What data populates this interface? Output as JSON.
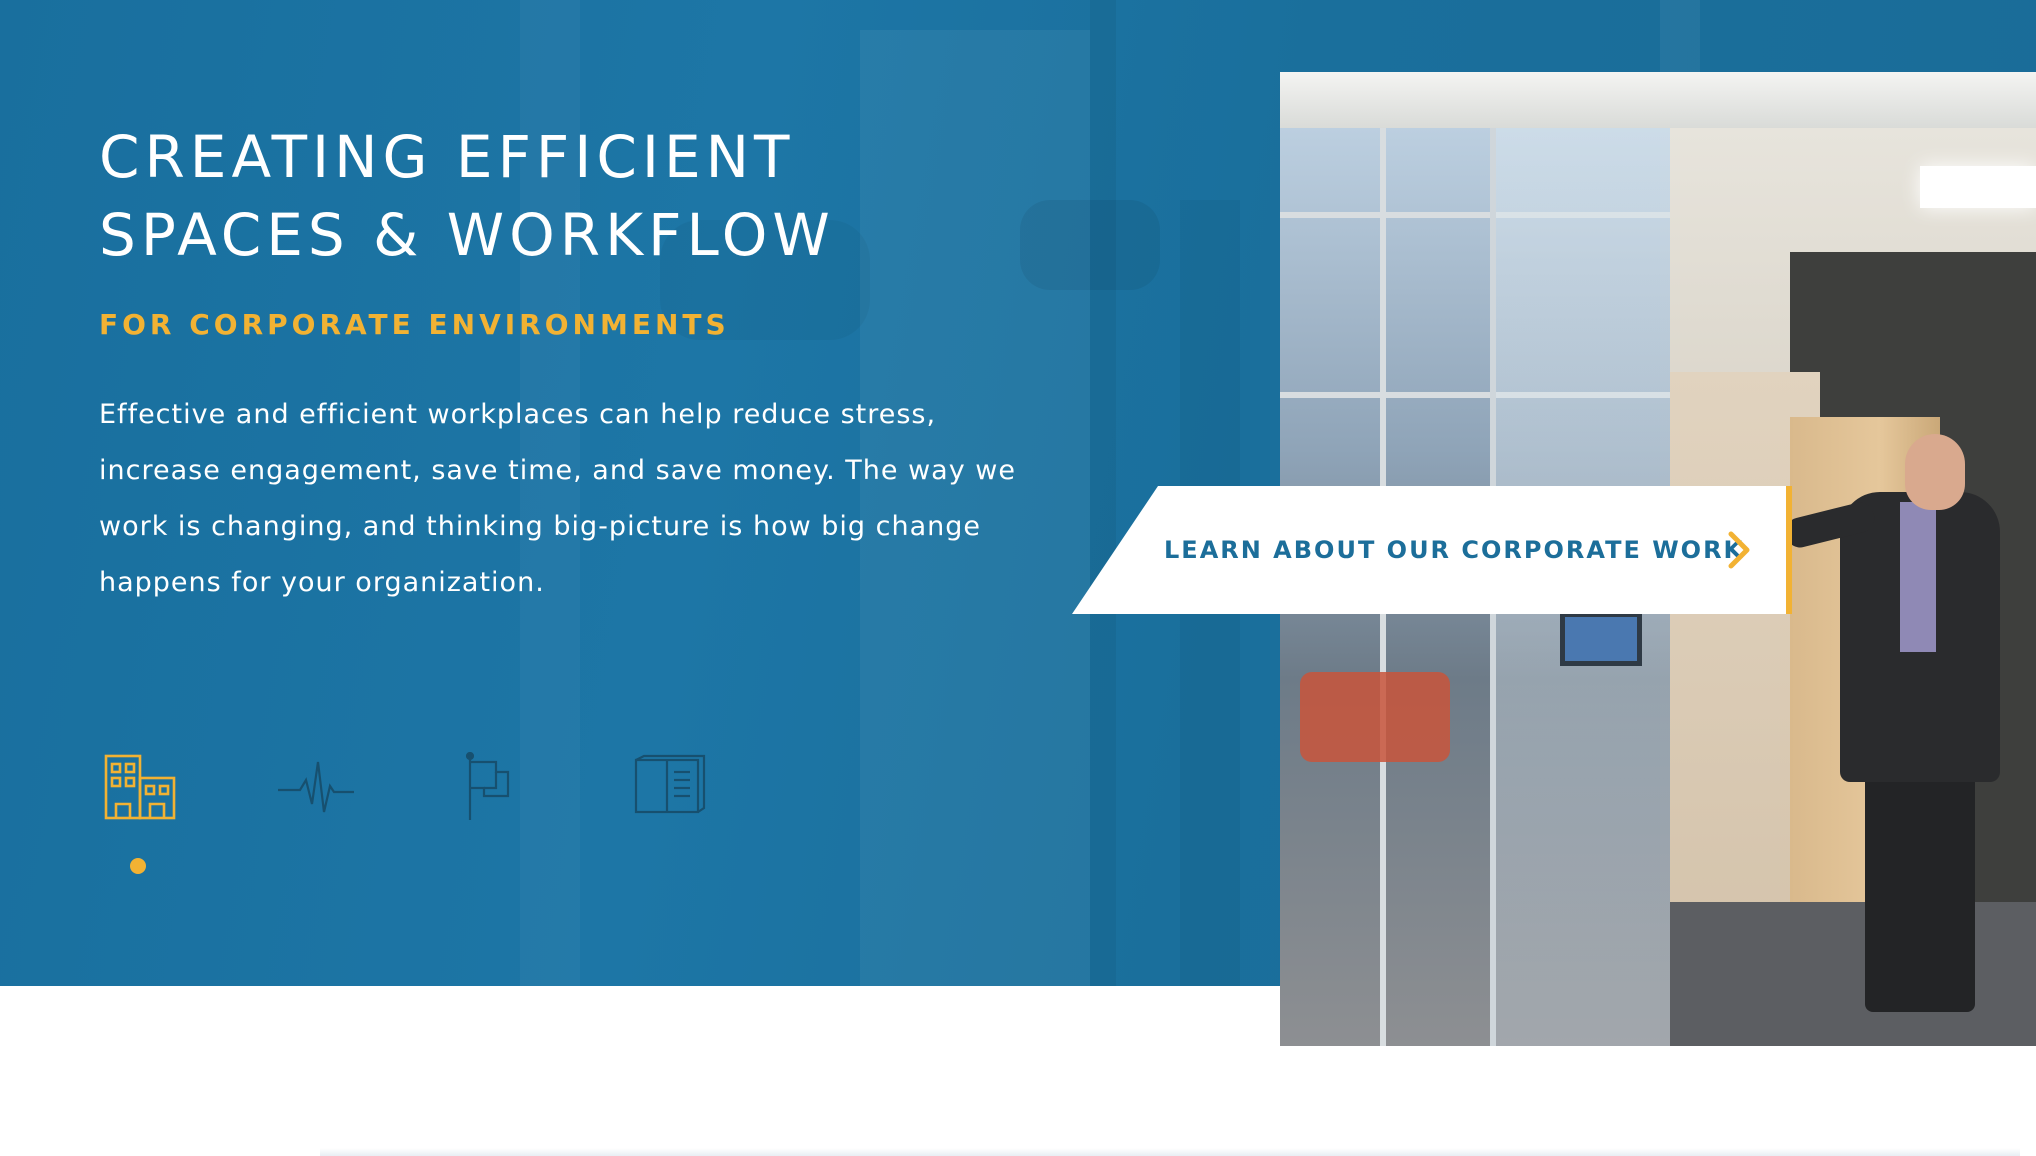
{
  "hero": {
    "title_line1": "CREATING EFFICIENT",
    "title_line2": "SPACES & WORKFLOW",
    "subtitle": "FOR CORPORATE ENVIRONMENTS",
    "body": "Effective and efficient workplaces can help reduce stress, increase engagement, save time, and save money. The way we work is changing, and thinking big-picture is how big change happens for your organization."
  },
  "cta": {
    "label": "LEARN ABOUT OUR CORPORATE WORK",
    "arrow_icon": "chevron-right-icon"
  },
  "sectors": {
    "items": [
      {
        "icon": "buildings-icon",
        "active": true
      },
      {
        "icon": "heartbeat-icon",
        "active": false
      },
      {
        "icon": "flag-icon",
        "active": false
      },
      {
        "icon": "book-icon",
        "active": false
      }
    ],
    "active_index": 0
  },
  "colors": {
    "hero_blue": "#1a72a2",
    "accent_yellow": "#f2b233",
    "cta_text": "#1c6e9a",
    "inactive_icon": "#17506f"
  }
}
